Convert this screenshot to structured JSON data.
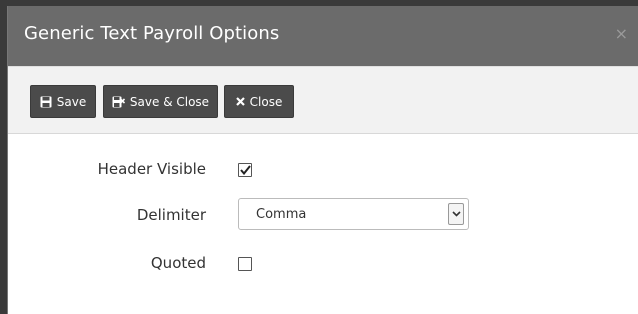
{
  "dialog": {
    "title": "Generic Text Payroll Options",
    "close_glyph": "×"
  },
  "toolbar": {
    "save_label": "Save",
    "save_close_label": "Save & Close",
    "close_label": "Close",
    "save_icon": "floppy-disk-icon",
    "save_close_icon": "floppy-disk-remove-icon",
    "close_icon": "x-icon"
  },
  "form": {
    "header_visible": {
      "label": "Header Visible",
      "checked": true
    },
    "delimiter": {
      "label": "Delimiter",
      "value": "Comma"
    },
    "quoted": {
      "label": "Quoted",
      "checked": false
    }
  },
  "colors": {
    "title_bar": "#6b6b6b",
    "button": "#4b4b4b",
    "toolbar_bg": "#f2f2f2"
  }
}
